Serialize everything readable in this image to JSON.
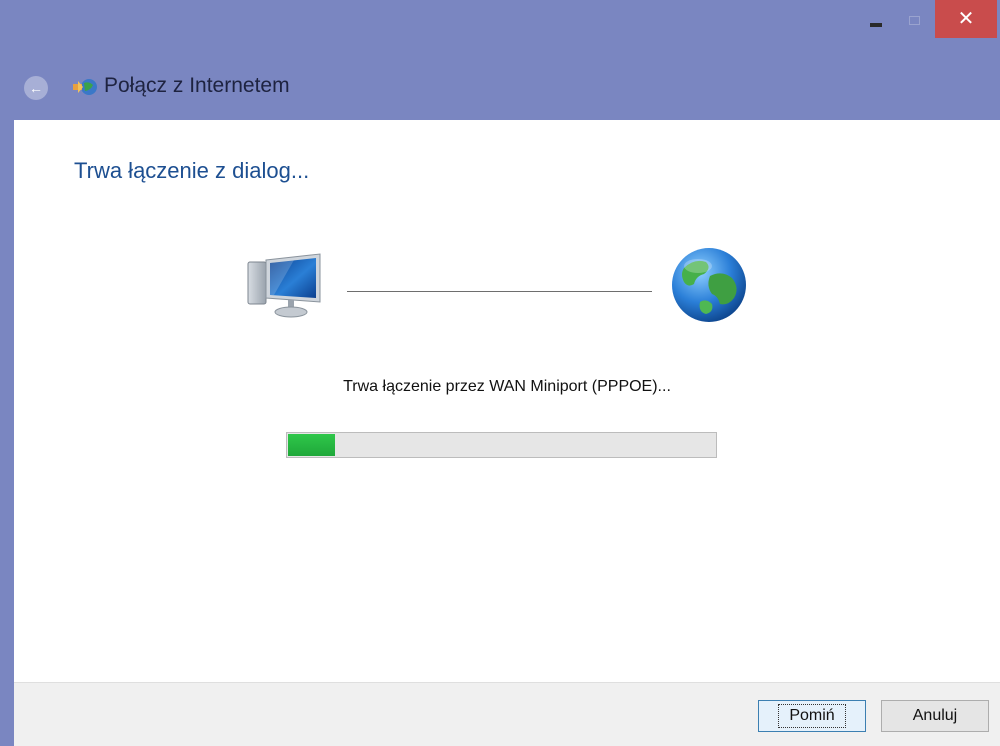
{
  "window": {
    "title": "Połącz z Internetem",
    "caption_buttons": {
      "minimize_icon": "minimize-icon",
      "maximize_icon": "maximize-icon",
      "close_label": "✕"
    }
  },
  "main": {
    "heading": "Trwa łączenie z dialog...",
    "status": "Trwa łączenie przez WAN Miniport (PPPOE)...",
    "progress_fraction": 0.11
  },
  "footer": {
    "skip_label": "Pomiń",
    "cancel_label": "Anuluj"
  },
  "colors": {
    "chrome": "#7a86c1",
    "heading": "#1d4f91",
    "progress": "#06b025",
    "close": "#c94c4c"
  }
}
